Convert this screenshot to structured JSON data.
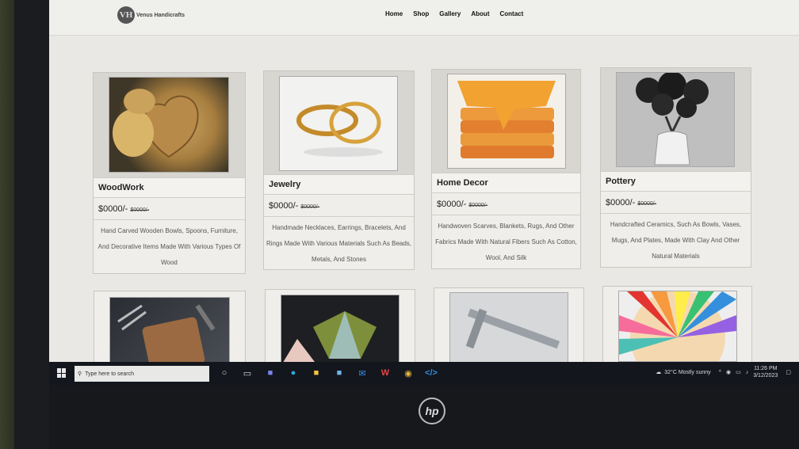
{
  "site": {
    "logo_text": "Venus Handicrafts",
    "logo_mark": "VH",
    "nav": [
      "Home",
      "Shop",
      "Gallery",
      "About",
      "Contact"
    ]
  },
  "products": [
    {
      "title": "WoodWork",
      "price": "$0000/-",
      "old_price": "$0000/-",
      "desc": "Hand Carved Wooden Bowls, Spoons, Furniture, And Decorative Items Made With Various Types Of Wood"
    },
    {
      "title": "Jewelry",
      "price": "$0000/-",
      "old_price": "$0000/-",
      "desc": "Handmade Necklaces, Earrings, Bracelets, And Rings Made With Various Materials Such As Beads, Metals, And Stones"
    },
    {
      "title": "Home Decor",
      "price": "$0000/-",
      "old_price": "$0000/-",
      "desc": "Handwoven Scarves, Blankets, Rugs, And Other Fabrics Made With Natural Fibers Such As Cotton, Wool, And Silk"
    },
    {
      "title": "Pottery",
      "price": "$0000/-",
      "old_price": "$0000/-",
      "desc": "Handcrafted Ceramics, Such As Bowls, Vases, Mugs, And Plates, Made With Clay And Other Natural Materials"
    }
  ],
  "taskbar": {
    "search_placeholder": "Type here to search",
    "weather": "32°C  Mostly sunny",
    "time": "11:26 PM",
    "date": "3/12/2023"
  },
  "brand": "hp",
  "colors": {
    "screen_bg": "#e9e8e4",
    "taskbar": "#13161d"
  }
}
